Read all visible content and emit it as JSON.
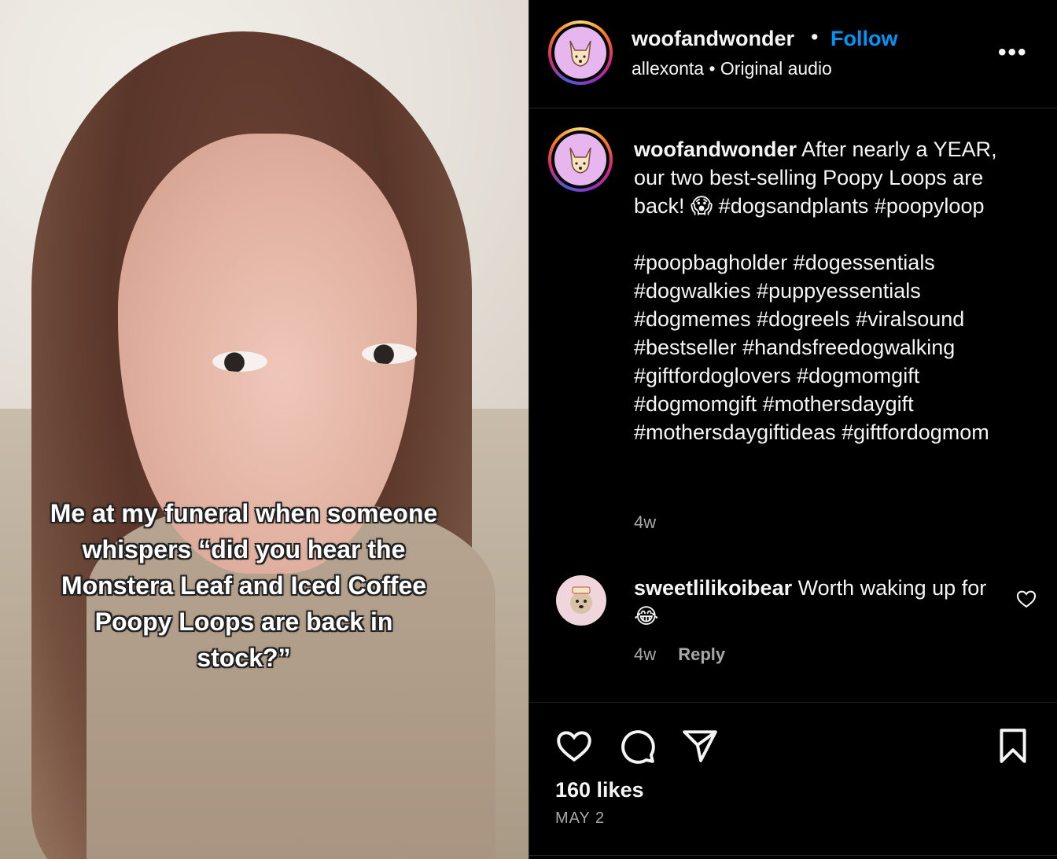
{
  "video": {
    "overlay_text": "Me at my funeral when someone whispers “did you hear the Monstera Leaf and Iced Coffee Poopy Loops are back in stock?”"
  },
  "header": {
    "username": "woofandwonder",
    "separator": "•",
    "follow_label": "Follow",
    "audio_user": "allexonta",
    "audio_label": "Original audio",
    "more_icon": "more-horizontal-icon"
  },
  "caption": {
    "username": "woofandwonder",
    "body": " After nearly a YEAR, our two best-selling Poopy Loops are back! 😱 #dogsandplants #poopyloop\n\n#poopbagholder #dogessentials #dogwalkies #puppyessentials #dogmemes #dogreels #viralsound #bestseller #handsfreedogwalking #giftfordoglovers #dogmomgift #dogmomgift #mothersdaygift #mothersdaygiftideas #giftfordogmom",
    "age": "4w"
  },
  "comment": {
    "username": "sweetlilikoibear",
    "text": " Worth waking up for 😂",
    "age": "4w",
    "reply_label": "Reply"
  },
  "actions": {
    "likes": "160 likes",
    "date": "MAY 2"
  },
  "colors": {
    "follow": "#0095f6",
    "secondary_text": "#a8a8a8",
    "background": "#000000"
  }
}
